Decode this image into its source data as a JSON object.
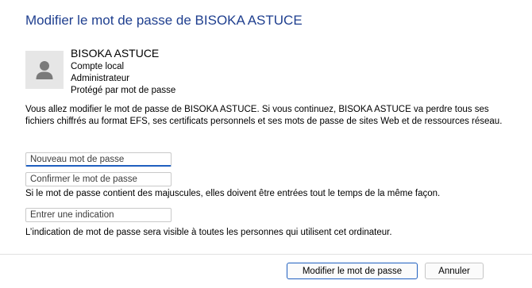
{
  "dialog": {
    "title": "Modifier le mot de passe de BISOKA ASTUCE"
  },
  "user": {
    "name": "BISOKA ASTUCE",
    "account_type": "Compte local",
    "role": "Administrateur",
    "protection": "Protégé par mot de passe"
  },
  "warning": "Vous allez modifier le mot de passe de BISOKA ASTUCE. Si vous continuez, BISOKA ASTUCE va perdre tous ses fichiers chiffrés au format EFS, ses certificats personnels et ses mots de passe de sites Web et de ressources réseau.",
  "fields": {
    "new_password": {
      "placeholder": "Nouveau mot de passe",
      "value": ""
    },
    "confirm_password": {
      "placeholder": "Confirmer le mot de passe",
      "value": ""
    },
    "case_note": "Si le mot de passe contient des majuscules, elles doivent être entrées tout le temps de la même façon.",
    "hint": {
      "placeholder": "Entrer une indication",
      "value": ""
    },
    "hint_note": "L’indication de mot de passe sera visible à toutes les personnes qui utilisent cet ordinateur."
  },
  "buttons": {
    "submit": "Modifier le mot de passe",
    "cancel": "Annuler"
  },
  "colors": {
    "title": "#1f3f8f",
    "accent": "#1f5fbf",
    "avatar_bg": "#e6e6e6",
    "avatar_figure": "#7a7a7a"
  },
  "icons": {
    "avatar": "user-silhouette-icon"
  }
}
